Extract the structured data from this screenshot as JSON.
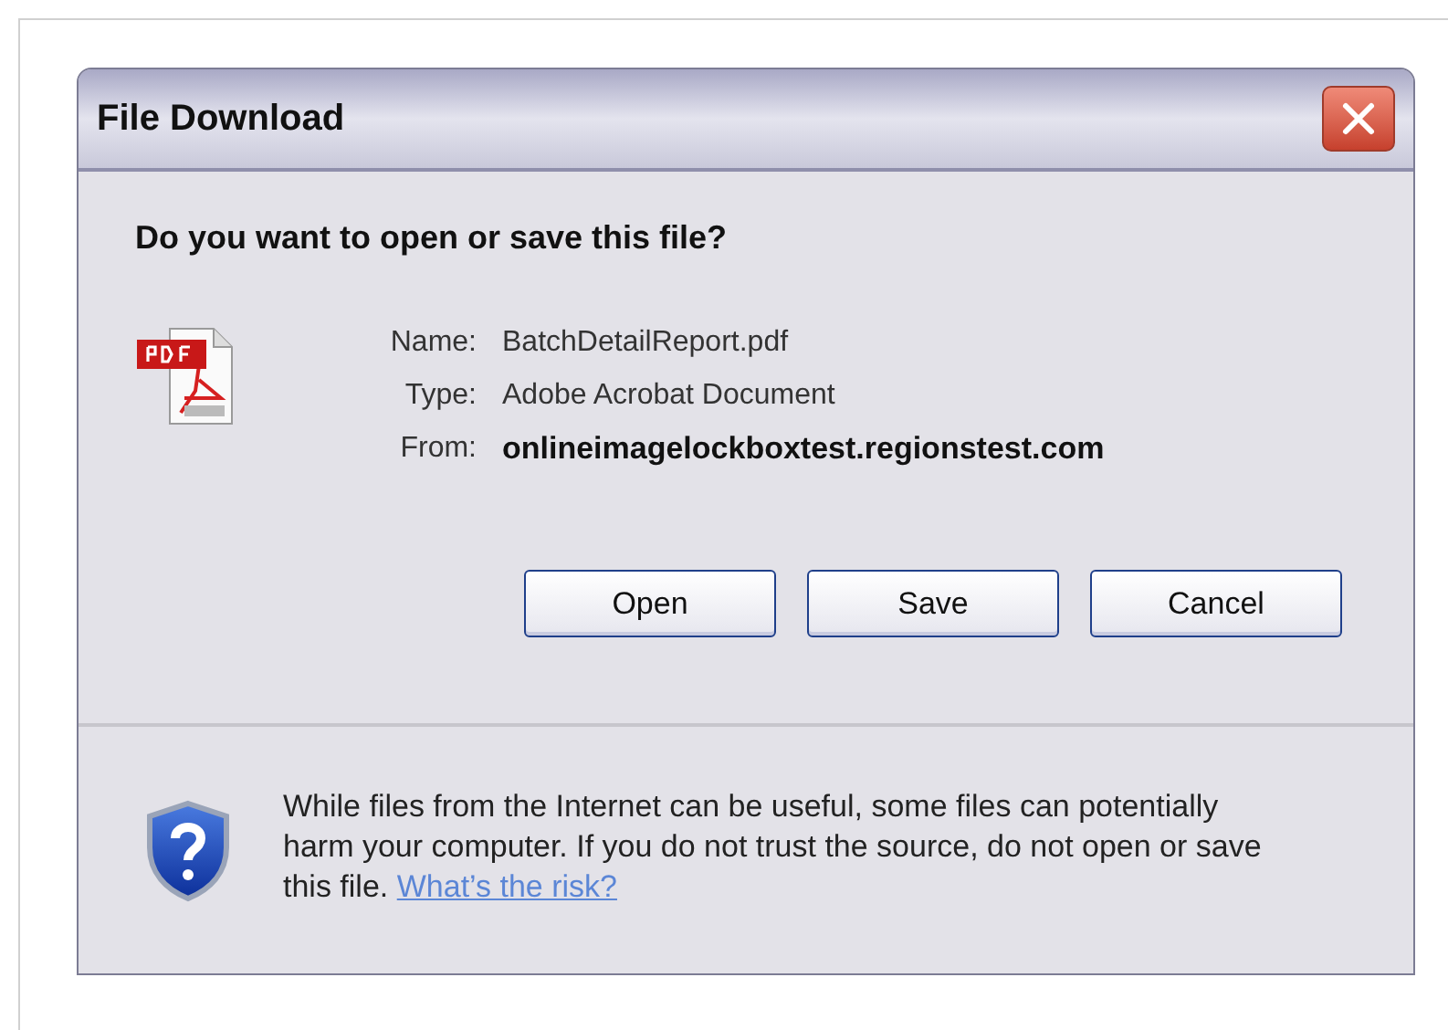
{
  "window": {
    "title": "File Download"
  },
  "question": "Do you want to open or save this file?",
  "details": [
    {
      "label": "Name:",
      "value": "BatchDetailReport.pdf",
      "bold": false
    },
    {
      "label": "Type:",
      "value": "Adobe Acrobat Document",
      "bold": false
    },
    {
      "label": "From:",
      "value": "onlineimagelockboxtest.regionstest.com",
      "bold": true
    }
  ],
  "buttons": [
    "Open",
    "Save",
    "Cancel"
  ],
  "warning": {
    "text": "While files from the Internet can be useful, some files can potentially harm your computer. If you do not trust the source, do not open or save this file.",
    "link": "What’s the risk?"
  }
}
